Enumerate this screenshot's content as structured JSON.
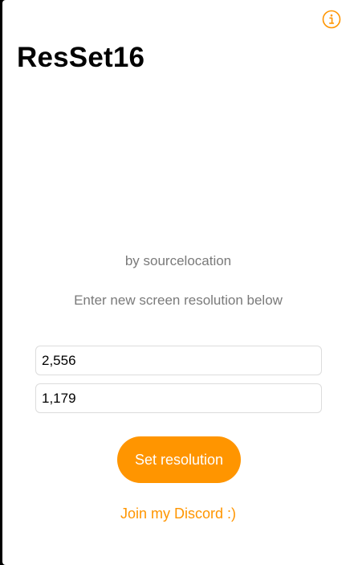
{
  "app": {
    "title": "ResSet16",
    "author": "by sourcelocation",
    "instructions": "Enter new screen resolution below"
  },
  "form": {
    "width_value": "2,556",
    "height_value": "1,179",
    "set_label": "Set resolution"
  },
  "links": {
    "discord_label": "Join my Discord :)"
  },
  "icons": {
    "info": "info-circle-icon"
  },
  "colors": {
    "accent": "#ff9500",
    "secondary_text": "#7a7a7a",
    "background": "#ffffff",
    "field_border": "#dcdcdc"
  }
}
